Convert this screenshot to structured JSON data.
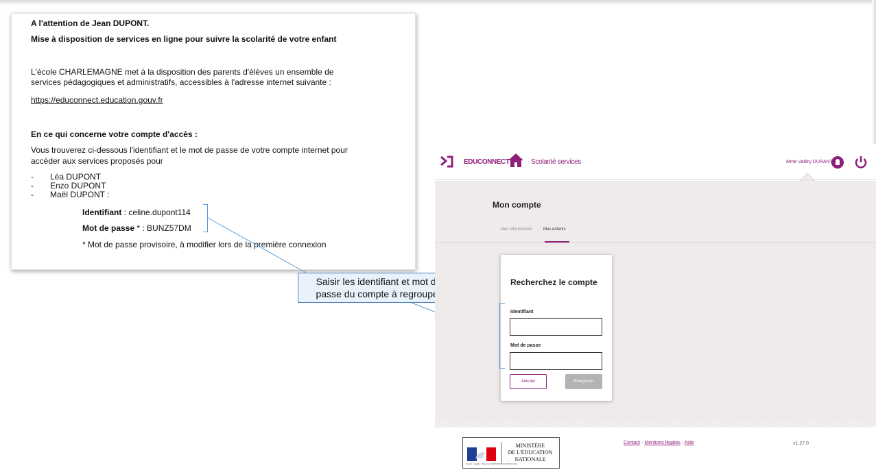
{
  "letter": {
    "line1": "A l'attention  de Jean DUPONT.",
    "line2": "Mise à disposition  de services en ligne pour suivre la scolarité de votre enfant",
    "para1_l1": "L'école CHARLEMAGNE  met à la disposition des parents d'élèves un ensemble de",
    "para1_l2": "services pédagogiques et administratifs, accessibles à l'adresse internet suivante :",
    "link": "https://educonnect.education.gouv.fr",
    "heading": "En ce qui concerne votre compte d'accès :",
    "para2_l1": "Vous trouverez  ci-dessous l'identifiant et le mot de passe de votre  compte internet pour",
    "para2_l2": "accéder aux services proposés pour",
    "children": [
      "Léa DUPONT",
      "Enzo DUPONT",
      "Maël DUPONT :"
    ],
    "id_label": "Identifiant",
    "id_value": " : celine.dupont114",
    "pw_label": "Mot de passe",
    "pw_value": " * : BUNZ57DM",
    "note": "*  Mot de passe provisoire, à modifier lors de la première connexion"
  },
  "callout": {
    "line1": "Saisir les identifiant et mot de",
    "line2": "passe du compte à regrouper"
  },
  "app": {
    "brand": "EDUCONNECT",
    "service": "Scolarité services",
    "user": "Mme Valéry DURANT",
    "page_title": "Mon compte",
    "tabs": [
      "Mes informations",
      "Mes enfants"
    ],
    "dialog": {
      "title": "Recherchez le compte",
      "id_label": "Identifiant",
      "pw_label": "Mot de passe",
      "cancel": "Annuler",
      "save": "Enregistrer"
    },
    "footer": {
      "ministere_l1": "MINISTÈRE",
      "ministere_l2": "DE L'ÉDUCATION",
      "ministere_l3": "NATIONALE",
      "flag_caption": "Liberté • Égalité • Fraternité  RÉPUBLIQUE FRANÇAISE",
      "links": [
        "Contact",
        "Mentions légales",
        "Aide"
      ],
      "link_sep": " - ",
      "version": "v1.27.0"
    }
  },
  "colors": {
    "brand": "#8e1f7a",
    "callout_border": "#4f81bd",
    "link": "#1a5fb4"
  }
}
